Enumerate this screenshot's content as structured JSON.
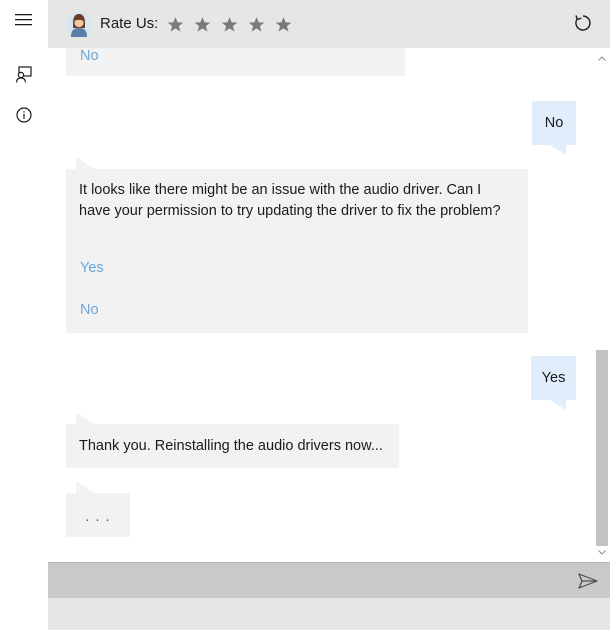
{
  "header": {
    "rate_label": "Rate Us:",
    "stars": [
      "★",
      "★",
      "★",
      "★",
      "★"
    ],
    "rating_selected": 0
  },
  "messages": {
    "prev_option_no": "No",
    "user_reply_1": "No",
    "bot_message_1": "It looks like there might be an issue with the audio driver. Can I have your permission to try updating the driver to fix the problem?",
    "bot_option_yes": "Yes",
    "bot_option_no": "No",
    "user_reply_2": "Yes",
    "bot_message_2": "Thank you. Reinstalling the audio drivers now...",
    "typing_indicator": ". . ."
  },
  "input": {
    "value": "",
    "placeholder": ""
  },
  "icons": {
    "menu": "hamburger-menu-icon",
    "chat": "chat-person-icon",
    "info": "info-icon",
    "refresh": "refresh-icon",
    "send": "send-icon",
    "avatar": "agent-avatar-icon"
  },
  "colors": {
    "header_bg": "#e6e6e6",
    "bot_bubble": "#f2f2f2",
    "user_bubble": "#e0edfa",
    "link": "#6aa7d8",
    "input_bar": "#c9c9c9",
    "star": "#7a7a7a"
  }
}
